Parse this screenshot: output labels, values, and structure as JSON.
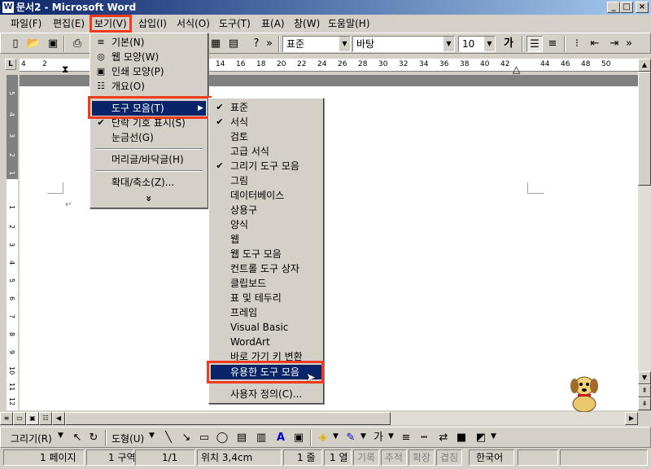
{
  "window": {
    "title": "문서2 - Microsoft Word"
  },
  "menubar": {
    "items": [
      "파일(F)",
      "편집(E)",
      "보기(V)",
      "삽입(I)",
      "서식(O)",
      "도구(T)",
      "표(A)",
      "창(W)",
      "도움말(H)"
    ]
  },
  "formatting": {
    "style": "표준",
    "font": "바탕",
    "size": "10",
    "bold": "가"
  },
  "ruler": {
    "top_numbers": [
      "4",
      "2",
      "",
      "",
      "",
      "",
      "",
      "",
      "14",
      "16",
      "18",
      "20",
      "22",
      "24",
      "26",
      "28",
      "30",
      "32",
      "34",
      "36",
      "38",
      "40",
      "42",
      "44",
      "46",
      "48",
      "50"
    ],
    "left_numbers": [
      "5",
      "4",
      "3",
      "2",
      "1",
      "",
      "1",
      "2",
      "3",
      "4",
      "5",
      "6",
      "7",
      "8",
      "9",
      "10",
      "11",
      "12"
    ]
  },
  "view_menu": {
    "items": [
      "기본(N)",
      "웹 모양(W)",
      "인쇄 모양(P)",
      "개요(O)",
      "도구 모음(T)",
      "단락 기호 표시(S)",
      "눈금선(G)",
      "머리글/바닥글(H)",
      "확대/축소(Z)..."
    ],
    "more": "»"
  },
  "toolbars_submenu": {
    "items": [
      "표준",
      "서식",
      "검토",
      "고급 서식",
      "그리기 도구 모음",
      "그림",
      "데이터베이스",
      "상용구",
      "양식",
      "웹",
      "웹 도구 모음",
      "컨트롤 도구 상자",
      "클립보드",
      "표 및 테두리",
      "프레임",
      "Visual Basic",
      "WordArt",
      "바로 가기 키 변환",
      "유용한 도구 모음",
      "사용자 정의(C)..."
    ],
    "checked": [
      "표준",
      "서식",
      "그리기 도구 모음"
    ]
  },
  "drawing_toolbar": {
    "draw": "그리기(R)",
    "shapes": "도형(U)"
  },
  "status": {
    "page": "1 페이지",
    "section": "1 구역",
    "pages": "1/1",
    "position": "위치 3,4cm",
    "line": "1 줄",
    "col": "1 열",
    "rec": "기록",
    "trk": "추적",
    "ext": "확장",
    "ovr": "겹침",
    "lang": "한국어"
  },
  "colors": {
    "highlight": "#0a246a",
    "annotation": "#ef3b1c"
  }
}
